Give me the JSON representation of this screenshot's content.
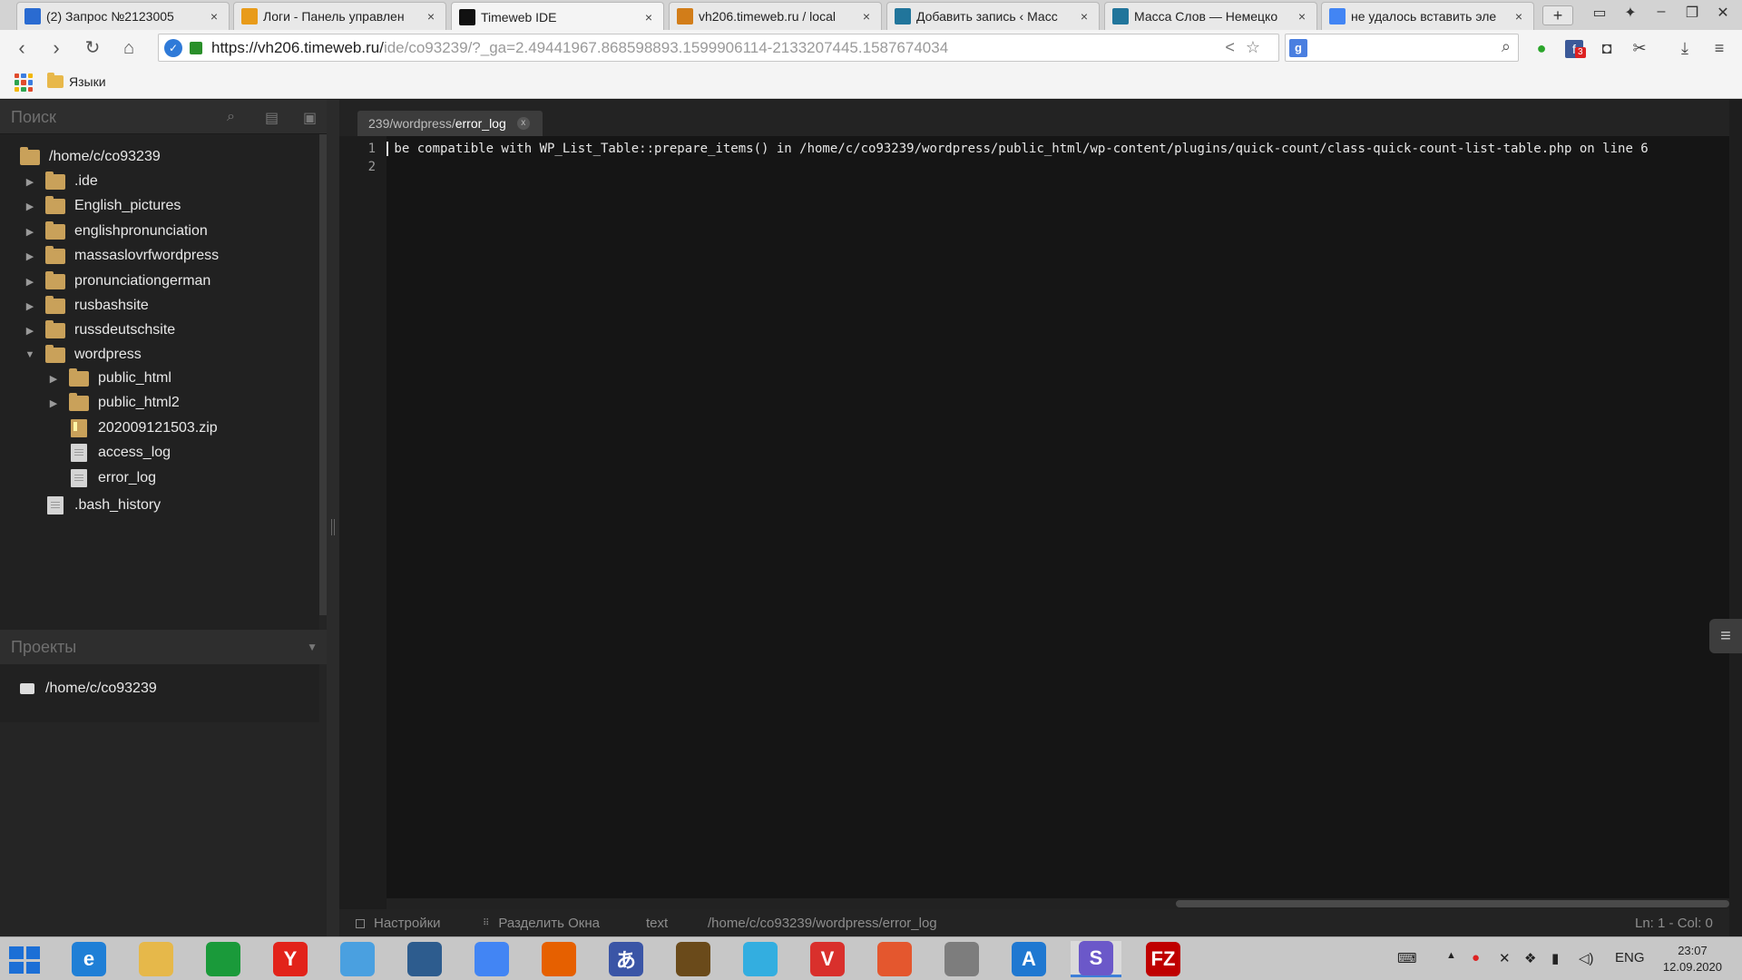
{
  "browser": {
    "tabs": [
      {
        "title": "(2) Запрос №2123005",
        "favicon": "ticket-icon",
        "color": "#2a6bd1"
      },
      {
        "title": "Логи - Панель управлен",
        "favicon": "chevron-right-icon",
        "color": "#e89b1a"
      },
      {
        "title": "Timeweb IDE",
        "favicon": "ide-icon",
        "color": "#111111"
      },
      {
        "title": "vh206.timeweb.ru / local",
        "favicon": "phpmyadmin-icon",
        "color": "#d27d19"
      },
      {
        "title": "Добавить запись ‹ Масс",
        "favicon": "wordpress-icon",
        "color": "#21759b"
      },
      {
        "title": "Масса Слов — Немецко",
        "favicon": "wordpress-icon",
        "color": "#21759b"
      },
      {
        "title": "не удалось вставить эле",
        "favicon": "google-icon",
        "color": "#4285f4"
      }
    ],
    "tab_close": "×",
    "new_tab": "+",
    "url_host": "https://vh206.timeweb.ru/",
    "url_path": "ide/co93239/?_ga=2.49441967.868598893.1599906114-2133207445.1587674034",
    "bookmark_folder": "Языки",
    "extension_badge": "3"
  },
  "ide": {
    "search_placeholder": "Поиск",
    "tree": [
      {
        "label": "/home/c/co93239",
        "type": "folder",
        "indent": 0,
        "expanded": true,
        "root": true
      },
      {
        "label": ".ide",
        "type": "folder",
        "indent": 1,
        "expanded": false
      },
      {
        "label": "English_pictures",
        "type": "folder",
        "indent": 1,
        "expanded": false
      },
      {
        "label": "englishpronunciation",
        "type": "folder",
        "indent": 1,
        "expanded": false
      },
      {
        "label": "massaslovrfwordpress",
        "type": "folder",
        "indent": 1,
        "expanded": false
      },
      {
        "label": "pronunciationgerman",
        "type": "folder",
        "indent": 1,
        "expanded": false
      },
      {
        "label": "rusbashsite",
        "type": "folder",
        "indent": 1,
        "expanded": false
      },
      {
        "label": "russdeutschsite",
        "type": "folder",
        "indent": 1,
        "expanded": false
      },
      {
        "label": "wordpress",
        "type": "folder",
        "indent": 1,
        "expanded": true
      },
      {
        "label": "public_html",
        "type": "folder",
        "indent": 2,
        "expanded": false
      },
      {
        "label": "public_html2",
        "type": "folder",
        "indent": 2,
        "expanded": false
      },
      {
        "label": "202009121503.zip",
        "type": "zip",
        "indent": 2
      },
      {
        "label": "access_log",
        "type": "file",
        "indent": 2
      },
      {
        "label": "error_log",
        "type": "file",
        "indent": 2
      },
      {
        "label": ".bash_history",
        "type": "file",
        "indent": 1
      }
    ],
    "projects_label": "Проекты",
    "project_item": "/home/c/co93239",
    "editor_tab_prefix": "239/wordpress/",
    "editor_tab_name": "error_log",
    "line_numbers": [
      "1",
      "2"
    ],
    "code_lines": [
      " be compatible with WP_List_Table::prepare_items() in /home/c/co93239/wordpress/public_html/wp-content/plugins/quick-count/class-quick-count-list-table.php on line 6",
      ""
    ],
    "status": {
      "settings": "Настройки",
      "split": "Разделить Окна",
      "mode": "text",
      "path": "/home/c/co93239/wordpress/error_log",
      "position": "Ln: 1 - Col: 0"
    }
  },
  "taskbar": {
    "apps": [
      {
        "name": "internet-explorer-icon",
        "glyph": "e",
        "color": "#1f7fd6"
      },
      {
        "name": "file-explorer-icon",
        "glyph": "",
        "color": "#e6b84a"
      },
      {
        "name": "store-icon",
        "glyph": "",
        "color": "#1a9a3a"
      },
      {
        "name": "yandex-browser-icon",
        "glyph": "Y",
        "color": "#e2231a"
      },
      {
        "name": "mail-icon",
        "glyph": "",
        "color": "#4aa0e0"
      },
      {
        "name": "remote-desktop-icon",
        "glyph": "",
        "color": "#2d5c8e"
      },
      {
        "name": "chrome-icon",
        "glyph": "",
        "color": "#4285f4"
      },
      {
        "name": "firefox-icon",
        "glyph": "",
        "color": "#e66000"
      },
      {
        "name": "translator-icon",
        "glyph": "あ",
        "color": "#3a55a6"
      },
      {
        "name": "wolf-app-icon",
        "glyph": "",
        "color": "#6a4a1a"
      },
      {
        "name": "butterfly-app-icon",
        "glyph": "",
        "color": "#33aee0"
      },
      {
        "name": "vivaldi-icon",
        "glyph": "V",
        "color": "#d9302c"
      },
      {
        "name": "brave-icon",
        "glyph": "",
        "color": "#e4572e"
      },
      {
        "name": "home-app-icon",
        "glyph": "",
        "color": "#7d7d7d"
      },
      {
        "name": "app-a-icon",
        "glyph": "A",
        "color": "#1f78d1"
      },
      {
        "name": "swirl-app-icon",
        "glyph": "S",
        "color": "#6b58c9"
      },
      {
        "name": "filezilla-icon",
        "glyph": "FZ",
        "color": "#bf0000"
      }
    ],
    "lang": "ENG",
    "time": "23:07",
    "date": "12.09.2020"
  }
}
